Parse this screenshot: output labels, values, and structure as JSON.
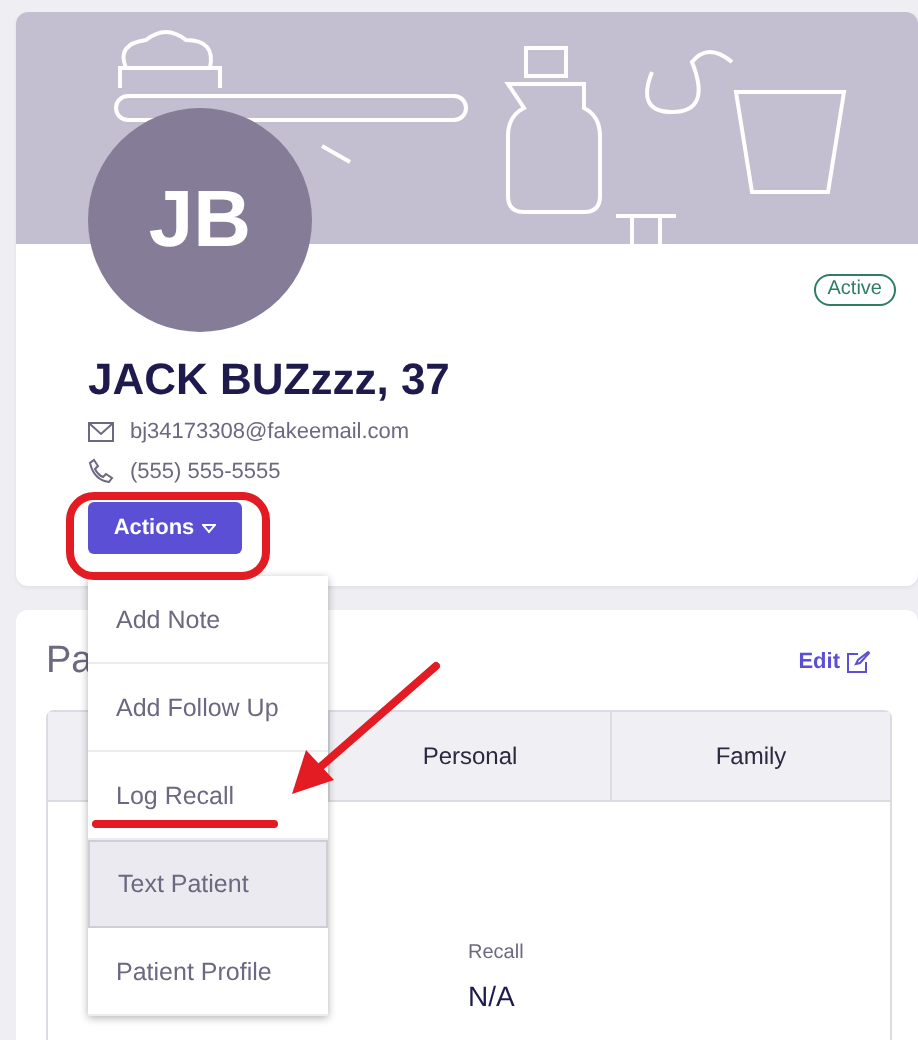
{
  "profile": {
    "initials": "JB",
    "status": "Active",
    "name": "JACK BUZzzz, 37",
    "email": "bj34173308@fakeemail.com",
    "phone": "(555) 555-5555",
    "actions_button": "Actions"
  },
  "actions_menu": [
    {
      "label": "Add Note",
      "selected": false
    },
    {
      "label": "Add Follow Up",
      "selected": false
    },
    {
      "label": "Log Recall",
      "selected": false
    },
    {
      "label": "Text Patient",
      "selected": true
    },
    {
      "label": "Patient Profile",
      "selected": false
    }
  ],
  "section": {
    "title": "Pa",
    "edit_link": "Edit",
    "tabs": [
      {
        "label": "Personal"
      },
      {
        "label": "Family"
      }
    ],
    "fields": [
      {
        "label": "Recall",
        "value": "N/A"
      }
    ]
  }
}
